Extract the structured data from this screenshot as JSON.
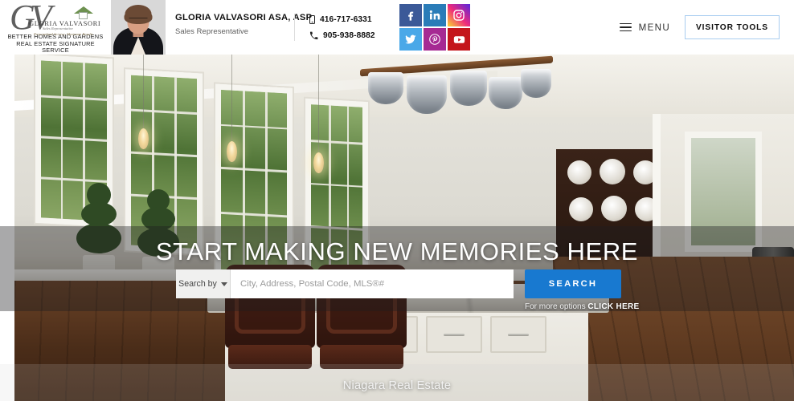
{
  "header": {
    "logo": {
      "script_initials": "GV",
      "brand_name": "GLORIA VALVASORI",
      "brand_sub1": "Sales Representative",
      "brand_sub2": "Personalized Service, Maximum Results",
      "tagline": "BETTER HOMES AND GARDENS REAL ESTATE SIGNATURE SERVICE",
      "roof_icon": "house-roof-icon"
    },
    "agent": {
      "photo_alt": "agent-headshot",
      "name": "GLORIA VALVASORI ASA, ASP",
      "role": "Sales Representative"
    },
    "contacts": [
      {
        "icon": "mobile-phone-icon",
        "number": "416-717-6331"
      },
      {
        "icon": "phone-handset-icon",
        "number": "905-938-8882"
      }
    ],
    "social": [
      {
        "name": "facebook",
        "icon": "facebook-icon",
        "color": "#3b5998",
        "label": "Facebook"
      },
      {
        "name": "linkedin",
        "icon": "linkedin-icon",
        "color": "#2a7cb8",
        "label": "LinkedIn"
      },
      {
        "name": "instagram",
        "icon": "instagram-icon",
        "color": "#c13584",
        "label": "Instagram"
      },
      {
        "name": "twitter",
        "icon": "twitter-icon",
        "color": "#4aa8e8",
        "label": "Twitter"
      },
      {
        "name": "pinterest",
        "icon": "pinterest-icon",
        "color": "#a62a93",
        "label": "Pinterest"
      },
      {
        "name": "youtube",
        "icon": "youtube-icon",
        "color": "#c4161c",
        "label": "YouTube"
      }
    ],
    "menu_label": "MENU",
    "menu_icon": "hamburger-menu-icon",
    "visitor_tools_label": "VISITOR TOOLS",
    "visitor_tools_border": "#a9cdf0"
  },
  "hero": {
    "background_alt": "luxury-kitchen-interior",
    "title": "START MAKING NEW MEMORIES HERE",
    "search": {
      "search_by_label": "Search by",
      "dropdown_icon": "chevron-down-icon",
      "placeholder": "City, Address, Postal Code, MLS®#",
      "value": "",
      "button_label": "SEARCH",
      "button_color": "#1879d0"
    },
    "more_options_prefix": "For more options ",
    "more_options_link": "CLICK HERE",
    "caption": "Niagara Real Estate"
  }
}
